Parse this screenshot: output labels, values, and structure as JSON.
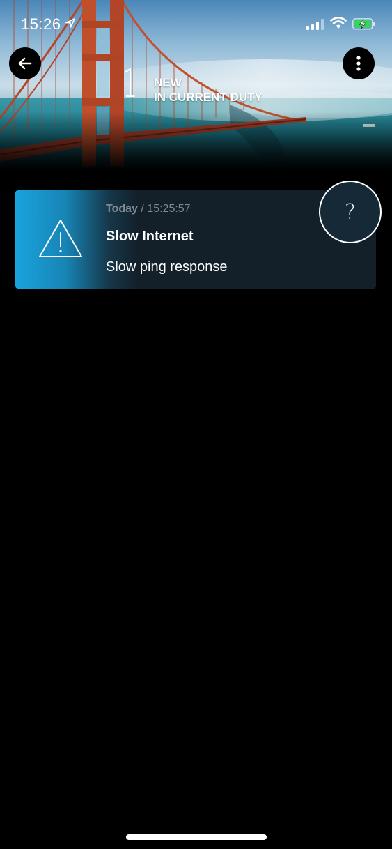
{
  "status_bar": {
    "time": "15:26",
    "icons": [
      "location-arrow-icon",
      "cellular-signal-icon",
      "wifi-icon",
      "battery-charging-icon"
    ]
  },
  "header": {
    "count": "1",
    "count_label_line1": "NEW",
    "count_label_line2": "IN CURRENT DUTY",
    "back_icon": "arrow-left-icon",
    "menu_icon": "more-vertical-icon"
  },
  "alerts": [
    {
      "date_label": "Today",
      "separator": "/",
      "time": "15:25:57",
      "title": "Slow Internet",
      "message": "Slow ping response",
      "icon": "warning-triangle-icon"
    }
  ],
  "help_button": {
    "label": "?"
  },
  "colors": {
    "accent": "#1aa3dd",
    "card_bg": "#13202a",
    "background": "#000000"
  }
}
